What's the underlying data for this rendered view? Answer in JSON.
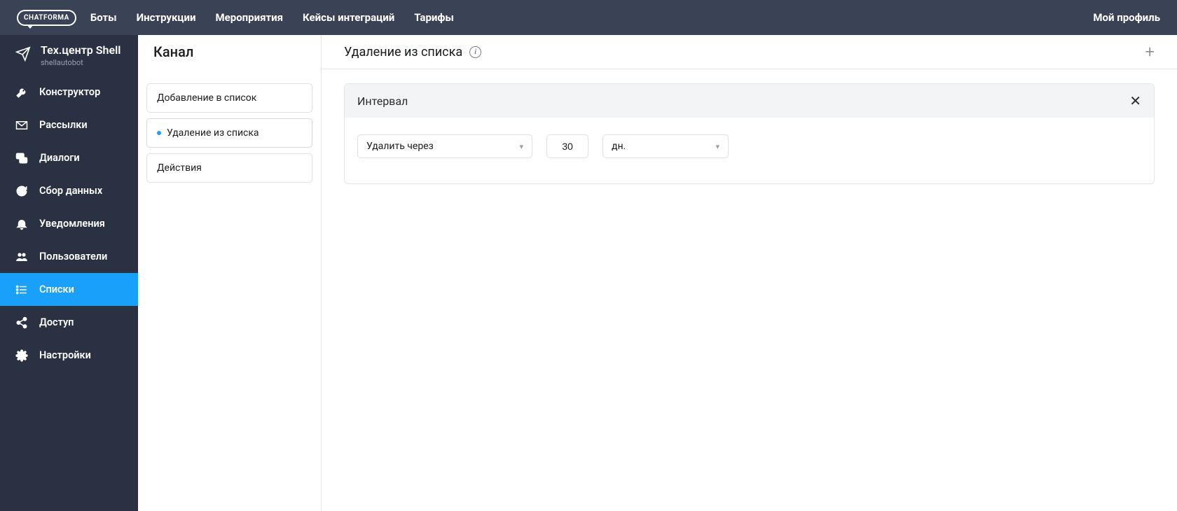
{
  "topnav": {
    "logo": "CHATFORMA",
    "links": [
      "Боты",
      "Инструкции",
      "Мероприятия",
      "Кейсы интеграций",
      "Тарифы"
    ],
    "profile": "Мой профиль"
  },
  "bot": {
    "title": "Тех.центр Shell",
    "sub": "shellautobot"
  },
  "sidebar": {
    "items": [
      {
        "label": "Конструктор"
      },
      {
        "label": "Рассылки"
      },
      {
        "label": "Диалоги"
      },
      {
        "label": "Сбор данных"
      },
      {
        "label": "Уведомления"
      },
      {
        "label": "Пользователи"
      },
      {
        "label": "Списки"
      },
      {
        "label": "Доступ"
      },
      {
        "label": "Настройки"
      }
    ],
    "active_index": 6
  },
  "col2": {
    "title": "Канал",
    "items": [
      {
        "label": "Добавление в список"
      },
      {
        "label": "Удаление из списка"
      },
      {
        "label": "Действия"
      }
    ],
    "active_index": 1
  },
  "main": {
    "title": "Удаление из списка",
    "card": {
      "title": "Интервал",
      "action_select": "Удалить через",
      "value": "30",
      "unit_select": "дн."
    }
  }
}
